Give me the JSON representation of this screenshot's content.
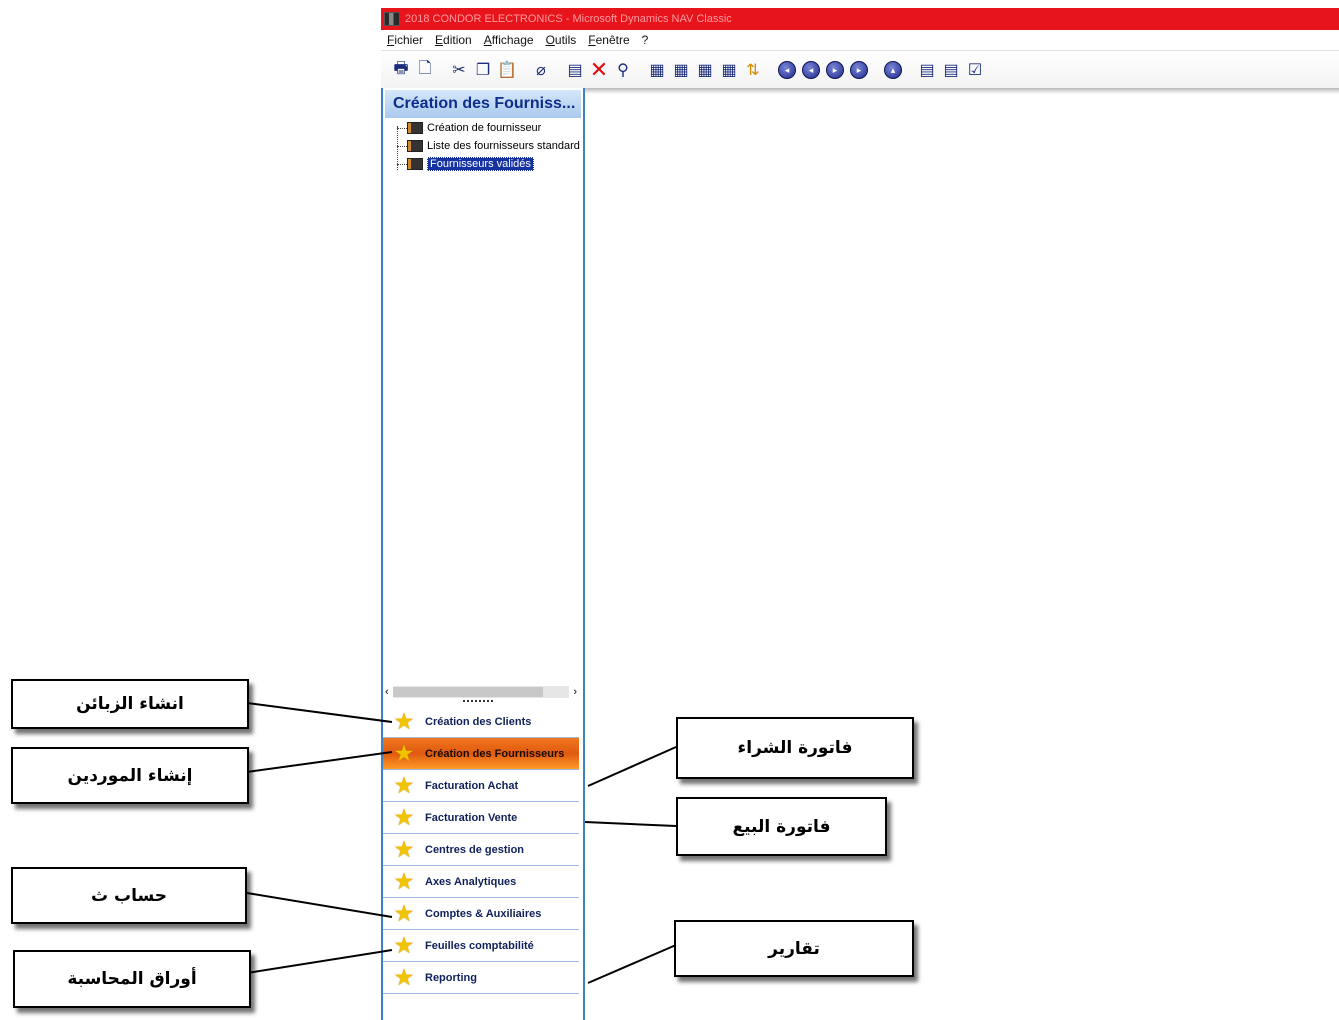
{
  "window": {
    "title": "2018 CONDOR ELECTRONICS - Microsoft Dynamics NAV Classic"
  },
  "menu": [
    "Fichier",
    "Edition",
    "Affichage",
    "Outils",
    "Fenêtre",
    "?"
  ],
  "toolbar_icons": [
    "print-icon",
    "print-preview-icon",
    "cut-icon",
    "copy-icon",
    "paste-icon",
    "attach-icon",
    "new-icon",
    "delete-icon",
    "find-icon",
    "form-icon",
    "card-icon",
    "list-icon",
    "table-icon",
    "sort-icon",
    "first-record-icon",
    "previous-record-icon",
    "next-record-icon",
    "last-record-icon",
    "info-icon",
    "post-icon",
    "post-print-icon",
    "check-icon"
  ],
  "nav": {
    "header": "Création des Fourniss...",
    "tree": [
      {
        "label": "Création de fournisseur",
        "selected": false
      },
      {
        "label": "Liste des fournisseurs standard",
        "selected": false
      },
      {
        "label": "Fournisseurs validés",
        "selected": true
      }
    ],
    "buttons": [
      {
        "label": "Création des Clients",
        "active": false
      },
      {
        "label": "Création des Fournisseurs",
        "active": true
      },
      {
        "label": "Facturation Achat",
        "active": false
      },
      {
        "label": "Facturation Vente",
        "active": false
      },
      {
        "label": "Centres de gestion",
        "active": false
      },
      {
        "label": "Axes Analytiques",
        "active": false
      },
      {
        "label": "Comptes & Auxiliaires",
        "active": false
      },
      {
        "label": "Feuilles comptabilité",
        "active": false
      },
      {
        "label": "Reporting",
        "active": false
      }
    ]
  },
  "callouts": {
    "clients": "انشاء الزبائن",
    "suppliers": "إنشاء الموردين",
    "accounts": "حساب ث",
    "sheets": "أوراق المحاسبة",
    "purchase": "فاتورة الشراء",
    "sales": "فاتورة البيع",
    "reports": "تقارير"
  }
}
